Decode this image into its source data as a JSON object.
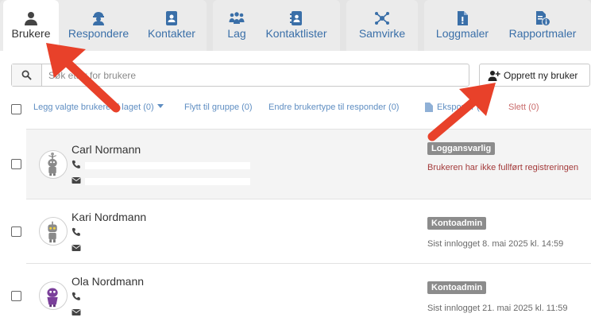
{
  "tabs": [
    {
      "label": "Brukere",
      "icon": "person-icon",
      "active": true
    },
    {
      "label": "Respondere",
      "icon": "respondent-icon",
      "active": false
    },
    {
      "label": "Kontakter",
      "icon": "contact-card-icon",
      "active": false
    },
    {
      "label": "Lag",
      "icon": "team-icon",
      "active": false
    },
    {
      "label": "Kontaktlister",
      "icon": "contact-list-icon",
      "active": false
    },
    {
      "label": "Samvirke",
      "icon": "network-icon",
      "active": false
    },
    {
      "label": "Loggmaler",
      "icon": "log-template-icon",
      "active": false
    },
    {
      "label": "Rapportmaler",
      "icon": "report-template-icon",
      "active": false
    }
  ],
  "search": {
    "placeholder": "Søk etter for brukere",
    "value": ""
  },
  "create_button": {
    "label": "Opprett ny bruker",
    "icon": "add-user-icon"
  },
  "bulk_actions": {
    "add_to_team": "Legg valgte brukere til laget (0)",
    "move_to_group": "Flytt til gruppe (0)",
    "change_type": "Endre brukertype til responder (0)",
    "export": "Eksporter (0)",
    "delete": "Slett (0)"
  },
  "users": [
    {
      "name": "Carl Normann",
      "role": "Loggansvarlig",
      "status": "Brukeren har ikke fullført registreringen",
      "status_kind": "warning",
      "avatar": "robot-grey"
    },
    {
      "name": "Kari Nordmann",
      "role": "Kontoadmin",
      "status": "Sist innlogget 8. mai 2025 kl. 14:59",
      "status_kind": "info",
      "avatar": "robot-grey"
    },
    {
      "name": "Ola Nordmann",
      "role": "Kontoadmin",
      "status": "Sist innlogget 21. mai 2025 kl. 11:59",
      "status_kind": "info",
      "avatar": "robot-purple"
    }
  ],
  "colors": {
    "tab_label": "#3a6fa8",
    "link": "#5f8ec2",
    "delete": "#c96a6a",
    "badge_bg": "#8c8c8c",
    "warning_text": "#a33a3a",
    "annotation_arrow": "#e8412a"
  }
}
